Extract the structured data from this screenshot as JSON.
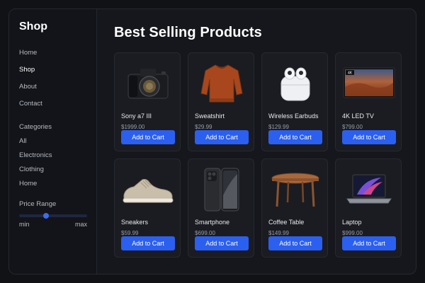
{
  "sidebar": {
    "brand": "Shop",
    "nav": [
      "Home",
      "Shop",
      "About",
      "Contact"
    ],
    "active_nav": "Shop",
    "categories_title": "Categories",
    "categories": [
      "All",
      "Electronics",
      "Clothing",
      "Home"
    ],
    "price_title": "Price Range",
    "price_min_label": "min",
    "price_max_label": "max",
    "price_slider_value": 0.4
  },
  "main": {
    "title": "Best Selling Products",
    "products": [
      {
        "name": "Sony a7 III",
        "price": "$1999.00",
        "icon": "camera-icon"
      },
      {
        "name": "Sweatshirt",
        "price": "$29.99",
        "icon": "sweatshirt-icon"
      },
      {
        "name": "Wireless Earbuds",
        "price": "$129.99",
        "icon": "earbuds-icon"
      },
      {
        "name": "4K LED TV",
        "price": "$799.00",
        "icon": "tv-icon"
      },
      {
        "name": "Sneakers",
        "price": "$59.99",
        "icon": "sneaker-icon"
      },
      {
        "name": "Smartphone",
        "price": "$699.00",
        "icon": "smartphone-icon"
      },
      {
        "name": "Coffee Table",
        "price": "$149.99",
        "icon": "table-icon"
      },
      {
        "name": "Laptop",
        "price": "$999.00",
        "icon": "laptop-icon"
      }
    ],
    "add_to_cart_label": "Add to Cart",
    "tv_badge": "4K"
  },
  "colors": {
    "background": "#111216",
    "panel": "#15171c",
    "card": "#1a1c22",
    "accent": "#2b5ff0"
  }
}
